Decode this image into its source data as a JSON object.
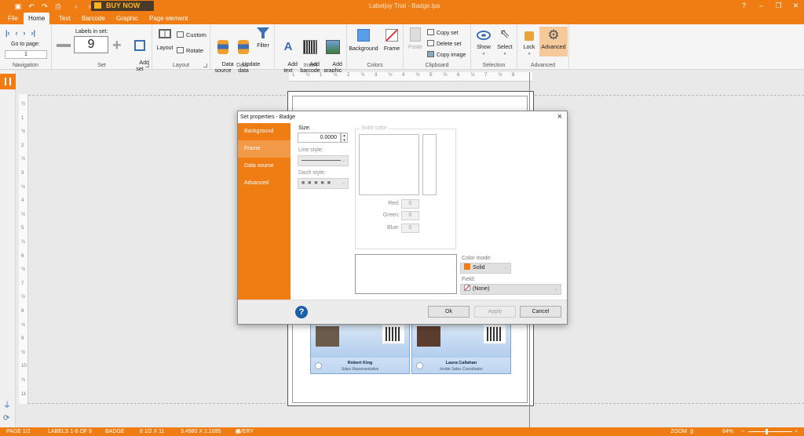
{
  "app": {
    "title": "Labeljoy Trial - Badge.lpa",
    "buy_now": "BUY NOW",
    "accent": "#f07d14"
  },
  "quick_access": {
    "icons": [
      "save-icon",
      "undo-icon",
      "redo-icon",
      "print-icon",
      "back-icon",
      "forward-icon"
    ]
  },
  "tabs": [
    "File",
    "Home",
    "Text",
    "Barcode",
    "Graphic",
    "Page element"
  ],
  "ribbon": {
    "navigation": {
      "label": "Navigation",
      "go_to_page": "Go to page:",
      "page_value": "1"
    },
    "set": {
      "label": "Set",
      "labels_in_set": "Labels in set:",
      "labels_value": "9",
      "add_set": "Add\nset"
    },
    "layout": {
      "label": "Layout",
      "layout_btn": "Layout",
      "custom": "Custom",
      "rotate": "Rotate"
    },
    "data": {
      "label": "Data",
      "data_source": "Data\nsource",
      "update_data": "Update\ndata",
      "filter": "Filter"
    },
    "insert": {
      "label": "Insert",
      "add_text": "Add\ntext",
      "add_barcode": "Add\nbarcode",
      "add_graphic": "Add\ngraphic"
    },
    "colors": {
      "label": "Colors",
      "background": "Background",
      "frame": "Frame"
    },
    "clipboard": {
      "label": "Clipboard",
      "paste": "Paste",
      "copy_set": "Copy set",
      "delete_set": "Delete set",
      "copy_image": "Copy image"
    },
    "selection": {
      "label": "Selection",
      "show": "Show",
      "select": "Select"
    },
    "advanced": {
      "label": "Advanced",
      "lock": "Lock",
      "advanced_btn": "Advanced"
    }
  },
  "ruler": {
    "top_ticks": [
      "1",
      "½",
      "1",
      "½",
      "2",
      "½",
      "3",
      "½",
      "4",
      "½",
      "5",
      "½",
      "6",
      "½",
      "7",
      "½",
      "8"
    ],
    "left_ticks": [
      "½",
      "1",
      "½",
      "2",
      "½",
      "3",
      "½",
      "4",
      "½",
      "5",
      "½",
      "6",
      "½",
      "7",
      "½",
      "8",
      "½",
      "9",
      "½",
      "10",
      "½",
      "11"
    ]
  },
  "badges": [
    {
      "name": "Robert King",
      "role": "Sales Representative"
    },
    {
      "name": "Laura Callahan",
      "role": "Inside Sales Coordinator"
    }
  ],
  "dialog": {
    "title": "Set properties - Badge",
    "nav": [
      "Background",
      "Frame",
      "Data source",
      "Advanced"
    ],
    "selected_nav": "Frame",
    "size_label": "Size:",
    "size_value": "0.0000",
    "line_style_label": "Line style:",
    "dash_style_label": "Dash style:",
    "solid_color_label": "Solid color",
    "red_label": "Red:",
    "red_value": "0",
    "green_label": "Green:",
    "green_value": "0",
    "blue_label": "Blue:",
    "blue_value": "0",
    "color_mode_label": "Color mode:",
    "color_mode_value": "Solid",
    "color_mode_swatch": "#f07d14",
    "field_label": "Field:",
    "field_value": "(None)",
    "ok": "Ok",
    "apply": "Apply",
    "cancel": "Cancel"
  },
  "status": {
    "page": "PAGE 1/2",
    "labels": "LABELS 1-8 OF 9",
    "set": "BADGE",
    "paper": "8 1/2 X 11",
    "size": "3.4980 X 2.1695",
    "template": "AVERY - 5843 BADGE",
    "zoom_label": "ZOOM",
    "zoom_value": "64%"
  }
}
